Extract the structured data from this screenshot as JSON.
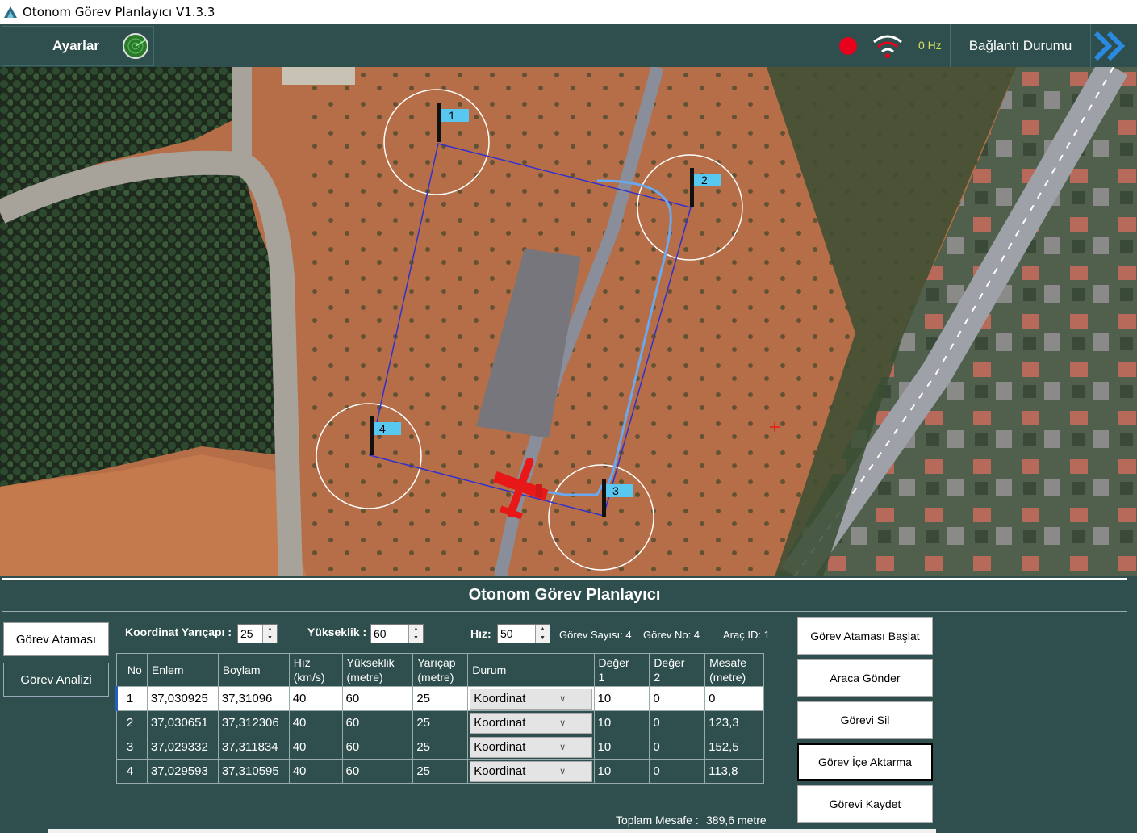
{
  "window": {
    "title": "Otonom Görev Planlayıcı V1.3.3"
  },
  "topbar": {
    "settings_label": "Ayarlar",
    "frequency": "0 Hz",
    "connection_label": "Bağlantı Durumu",
    "record_color": "#e8001c",
    "icons": [
      "radar-icon",
      "wifi-signal-icon",
      "double-chevron-right-icon"
    ]
  },
  "map": {
    "waypoint_labels": [
      "1",
      "2",
      "3",
      "4"
    ],
    "route_color": "#3030d0",
    "flight_path_color": "#6aa8f0",
    "aircraft_color": "#e81818"
  },
  "panel": {
    "title": "Otonom Görev Planlayıcı",
    "tabs": [
      "Görev Ataması",
      "Görev Analizi"
    ],
    "params": {
      "coord_radius_label": "Koordinat Yarıçapı :",
      "coord_radius_value": "25",
      "altitude_label": "Yükseklik :",
      "altitude_value": "60",
      "speed_label": "Hız:",
      "speed_value": "50",
      "mission_count": "Görev Sayısı: 4",
      "mission_no": "Görev No: 4",
      "vehicle_id": "Araç ID: 1"
    },
    "table": {
      "columns": [
        {
          "line1": "No",
          "line2": ""
        },
        {
          "line1": "Enlem",
          "line2": ""
        },
        {
          "line1": "Boylam",
          "line2": ""
        },
        {
          "line1": "Hız",
          "line2": "(km/s)"
        },
        {
          "line1": "Yükseklik",
          "line2": "(metre)"
        },
        {
          "line1": "Yarıçap",
          "line2": "(metre)"
        },
        {
          "line1": "Durum",
          "line2": ""
        },
        {
          "line1": "Değer",
          "line2": "1"
        },
        {
          "line1": "Değer",
          "line2": "2"
        },
        {
          "line1": "Mesafe",
          "line2": "(metre)"
        }
      ],
      "rows": [
        [
          "1",
          "37,030925",
          "37,31096",
          "40",
          "60",
          "25",
          "Koordinat",
          "10",
          "0",
          "0"
        ],
        [
          "2",
          "37,030651",
          "37,312306",
          "40",
          "60",
          "25",
          "Koordinat",
          "10",
          "0",
          "123,3"
        ],
        [
          "3",
          "37,029332",
          "37,311834",
          "40",
          "60",
          "25",
          "Koordinat",
          "10",
          "0",
          "152,5"
        ],
        [
          "4",
          "37,029593",
          "37,310595",
          "40",
          "60",
          "25",
          "Koordinat",
          "10",
          "0",
          "113,8"
        ]
      ]
    },
    "total_label": "Toplam Mesafe :",
    "total_value": "389,6 metre",
    "actions": [
      "Görev Ataması Başlat",
      "Araca Gönder",
      "Görevi Sil",
      "Görev İçe Aktarma",
      "Görevi Kaydet"
    ]
  }
}
